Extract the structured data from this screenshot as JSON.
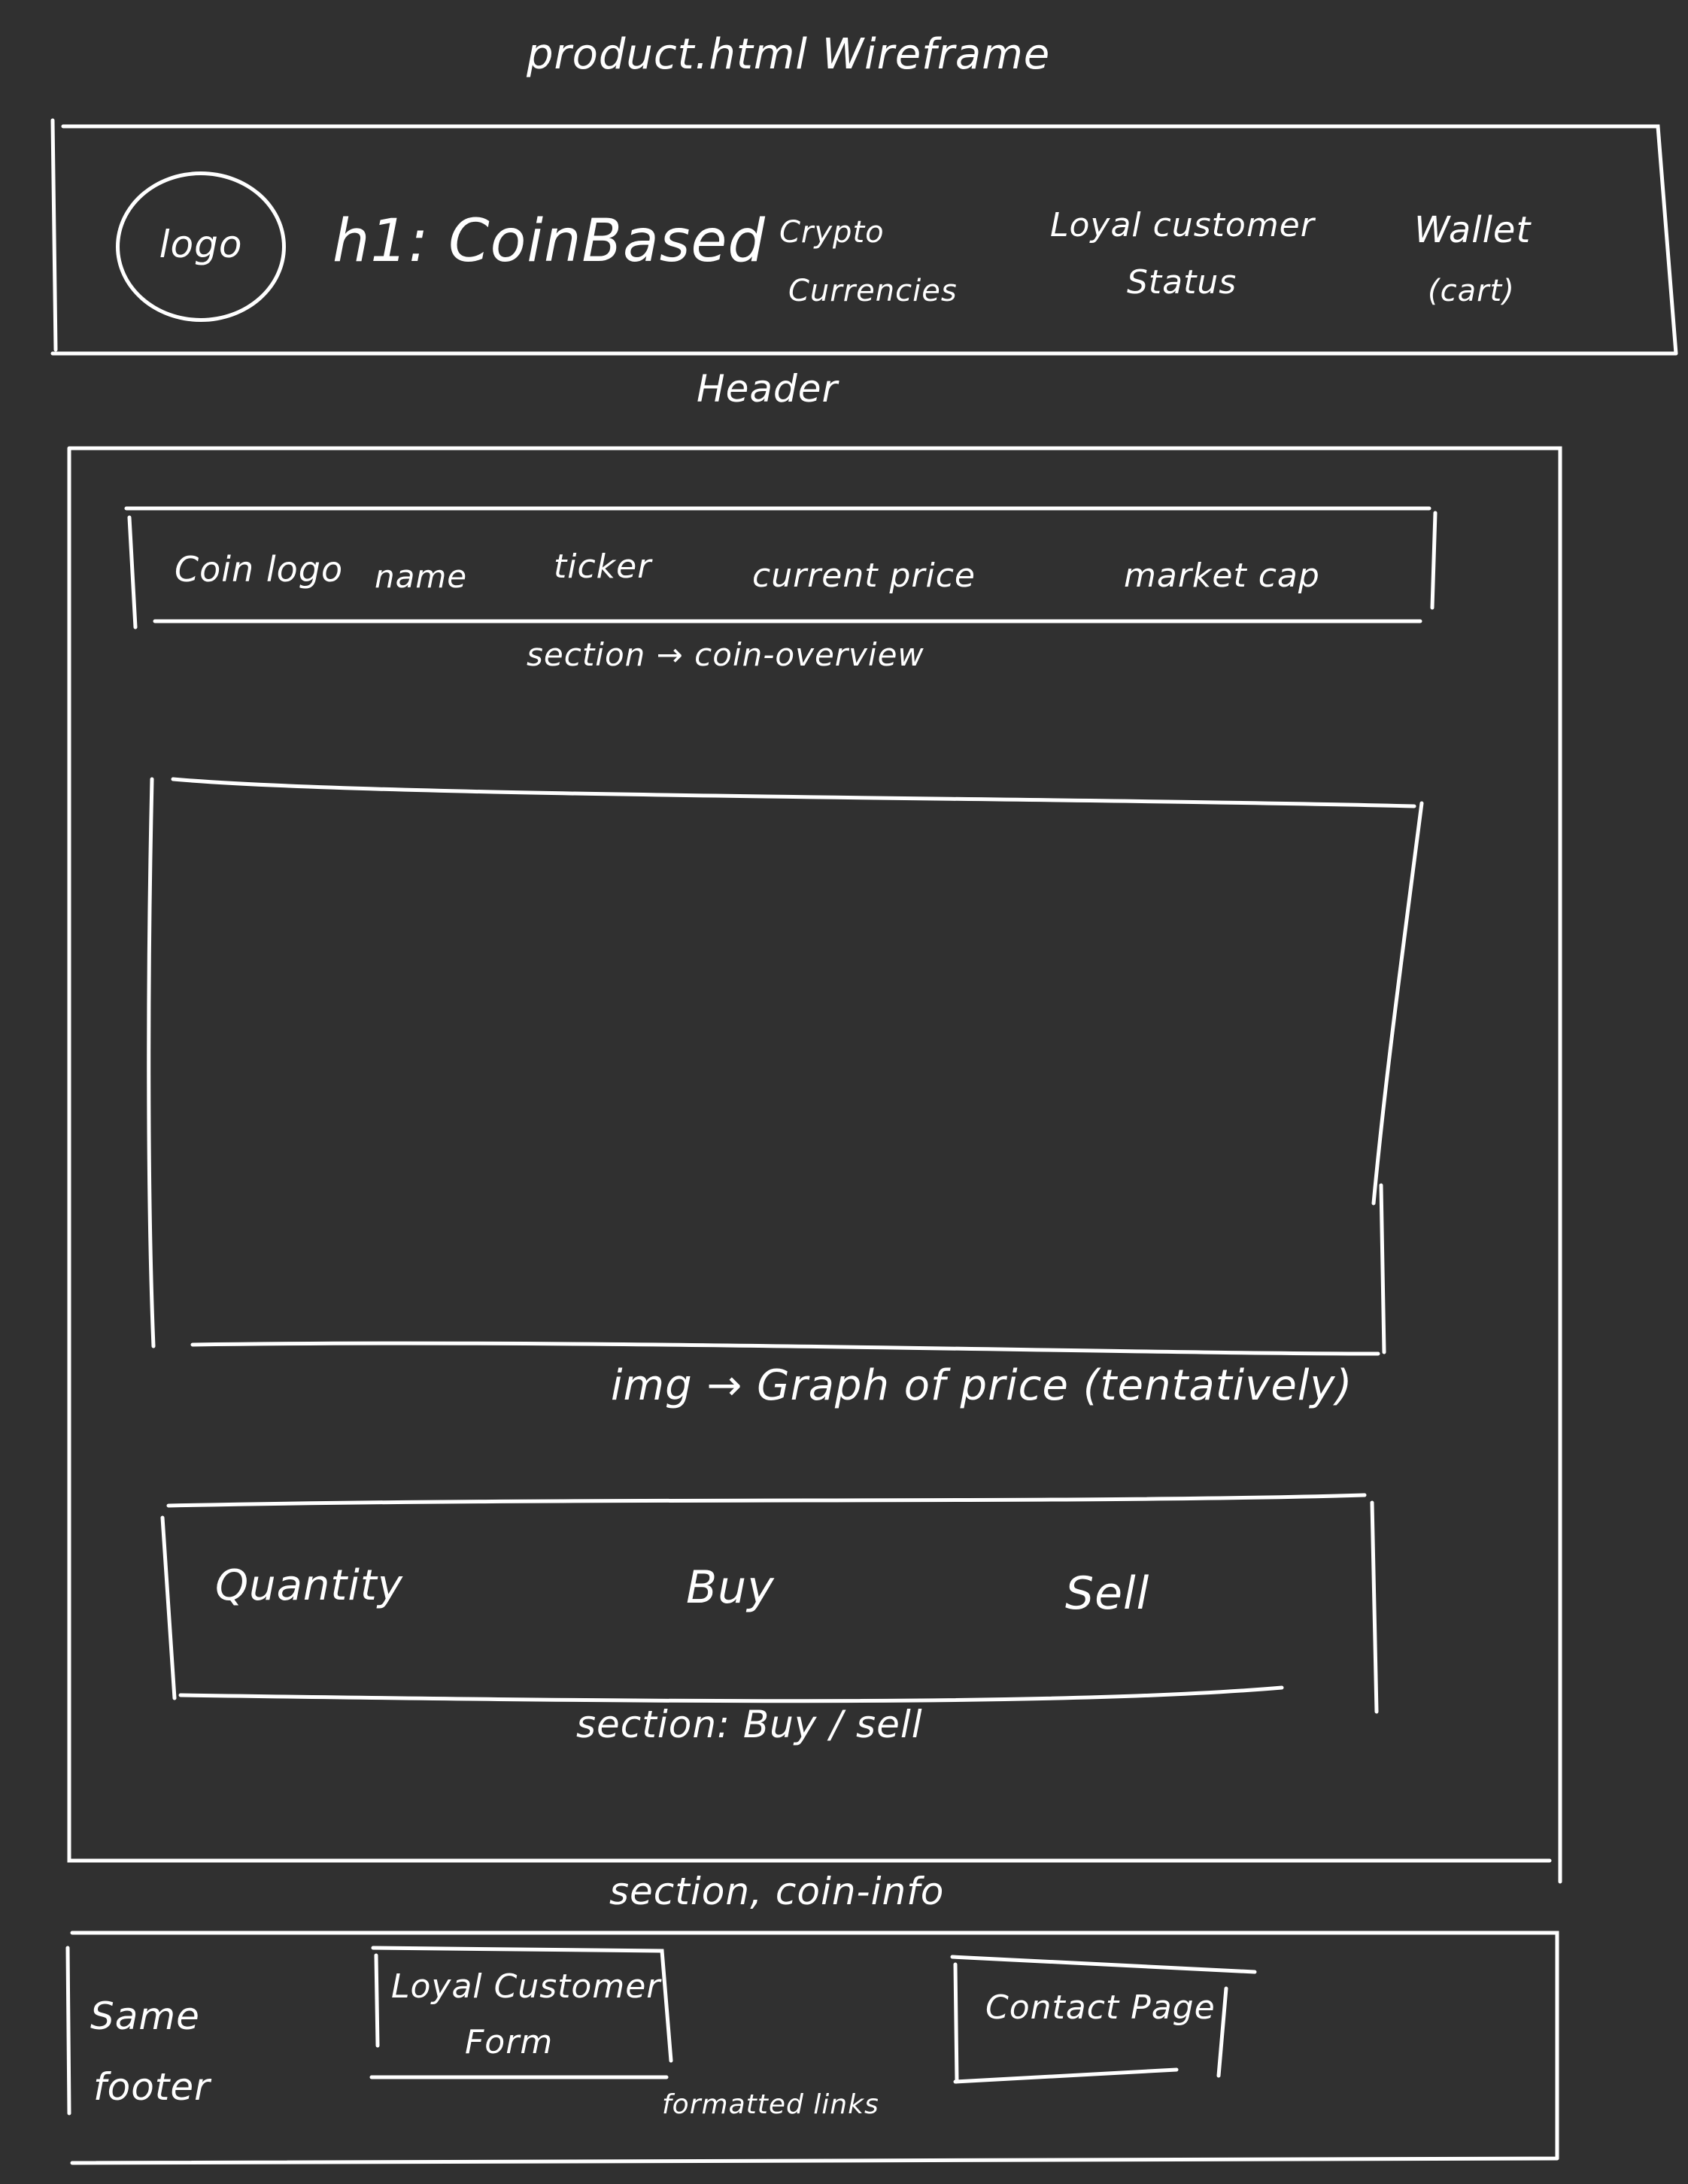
{
  "title": "product.html   Wireframe",
  "header": {
    "logo": "logo",
    "h1": "h1: CoinBased",
    "nav": [
      {
        "line1": "Crypto",
        "line2": "Currencies"
      },
      {
        "line1": "Loyal customer",
        "line2": "Status"
      },
      {
        "line1": "Wallet",
        "line2": "(cart)"
      }
    ],
    "caption": "Header"
  },
  "coin_overview": {
    "columns": [
      "Coin logo",
      "name",
      "ticker",
      "current price",
      "market cap"
    ],
    "caption": "section → coin-overview"
  },
  "graph": {
    "caption": "img → Graph of price   (tentatively)"
  },
  "buy_sell": {
    "items": [
      "Quantity",
      "Buy",
      "Sell"
    ],
    "caption": "section:  Buy / sell"
  },
  "coin_info": {
    "caption": "section,  coin-info"
  },
  "footer": {
    "same_line1": "Same",
    "same_line2": "footer",
    "link1_line1": "Loyal  Customer",
    "link1_line2": "Form",
    "link2": "Contact  Page",
    "caption": "formatted links"
  }
}
